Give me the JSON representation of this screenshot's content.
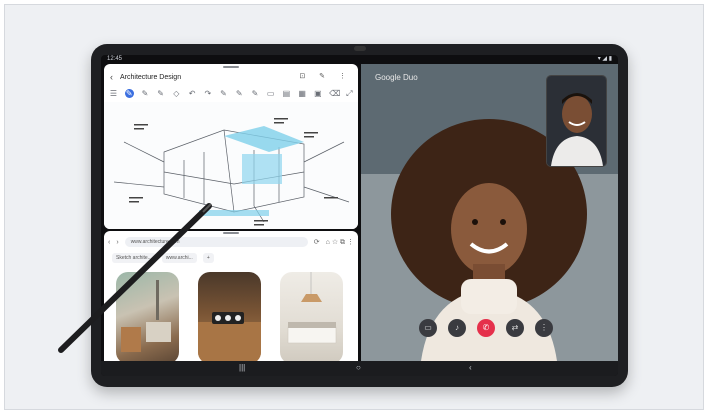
{
  "status": {
    "time": "12:45",
    "indicators": "▾ ◢ ▮"
  },
  "notes": {
    "title": "Architecture Design",
    "back_icon": "‹",
    "actions": "⊡ ✎ ⋮",
    "tools": [
      "☰",
      "✎",
      "✎",
      "✎",
      "◇",
      "↶",
      "↷",
      "✎",
      "✎",
      "✎",
      "▭",
      "▤",
      "▦",
      "▣",
      "⌫",
      "⤢"
    ],
    "active_tool_index": 1
  },
  "browser": {
    "back": "‹",
    "forward": "›",
    "url": "www.architecture.com",
    "reload": "⟳",
    "icons": "⌂ ☆ ⧉ ⋮",
    "tabs": [
      "Sketch archite...",
      "www.archi..."
    ],
    "add_tab": "+"
  },
  "duo": {
    "logo": "Google Duo",
    "buttons": [
      "▭",
      "♪",
      "✆",
      "⇄",
      "⋮"
    ]
  },
  "navbar": {
    "recent": "|||",
    "home": "○",
    "back": "‹"
  }
}
